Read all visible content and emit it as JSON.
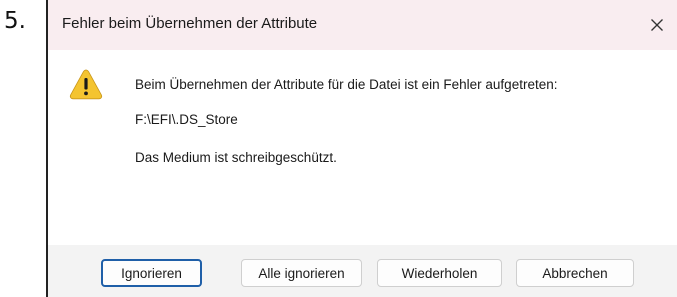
{
  "step_label": "5.",
  "dialog": {
    "title": "Fehler beim Übernehmen der Attribute",
    "close_icon": "close-icon",
    "warning_icon": "warning-icon",
    "message": "Beim Übernehmen der Attribute für die Datei ist ein Fehler aufgetreten:",
    "file_path": "F:\\EFI\\.DS_Store",
    "detail": "Das Medium ist schreibgeschützt."
  },
  "buttons": {
    "ignore": "Ignorieren",
    "ignore_all": "Alle ignorieren",
    "retry": "Wiederholen",
    "cancel": "Abbrechen"
  },
  "colors": {
    "titlebar": "#f9edf0",
    "warning_yellow": "#f4c430",
    "primary_border": "#1f5fa8"
  }
}
